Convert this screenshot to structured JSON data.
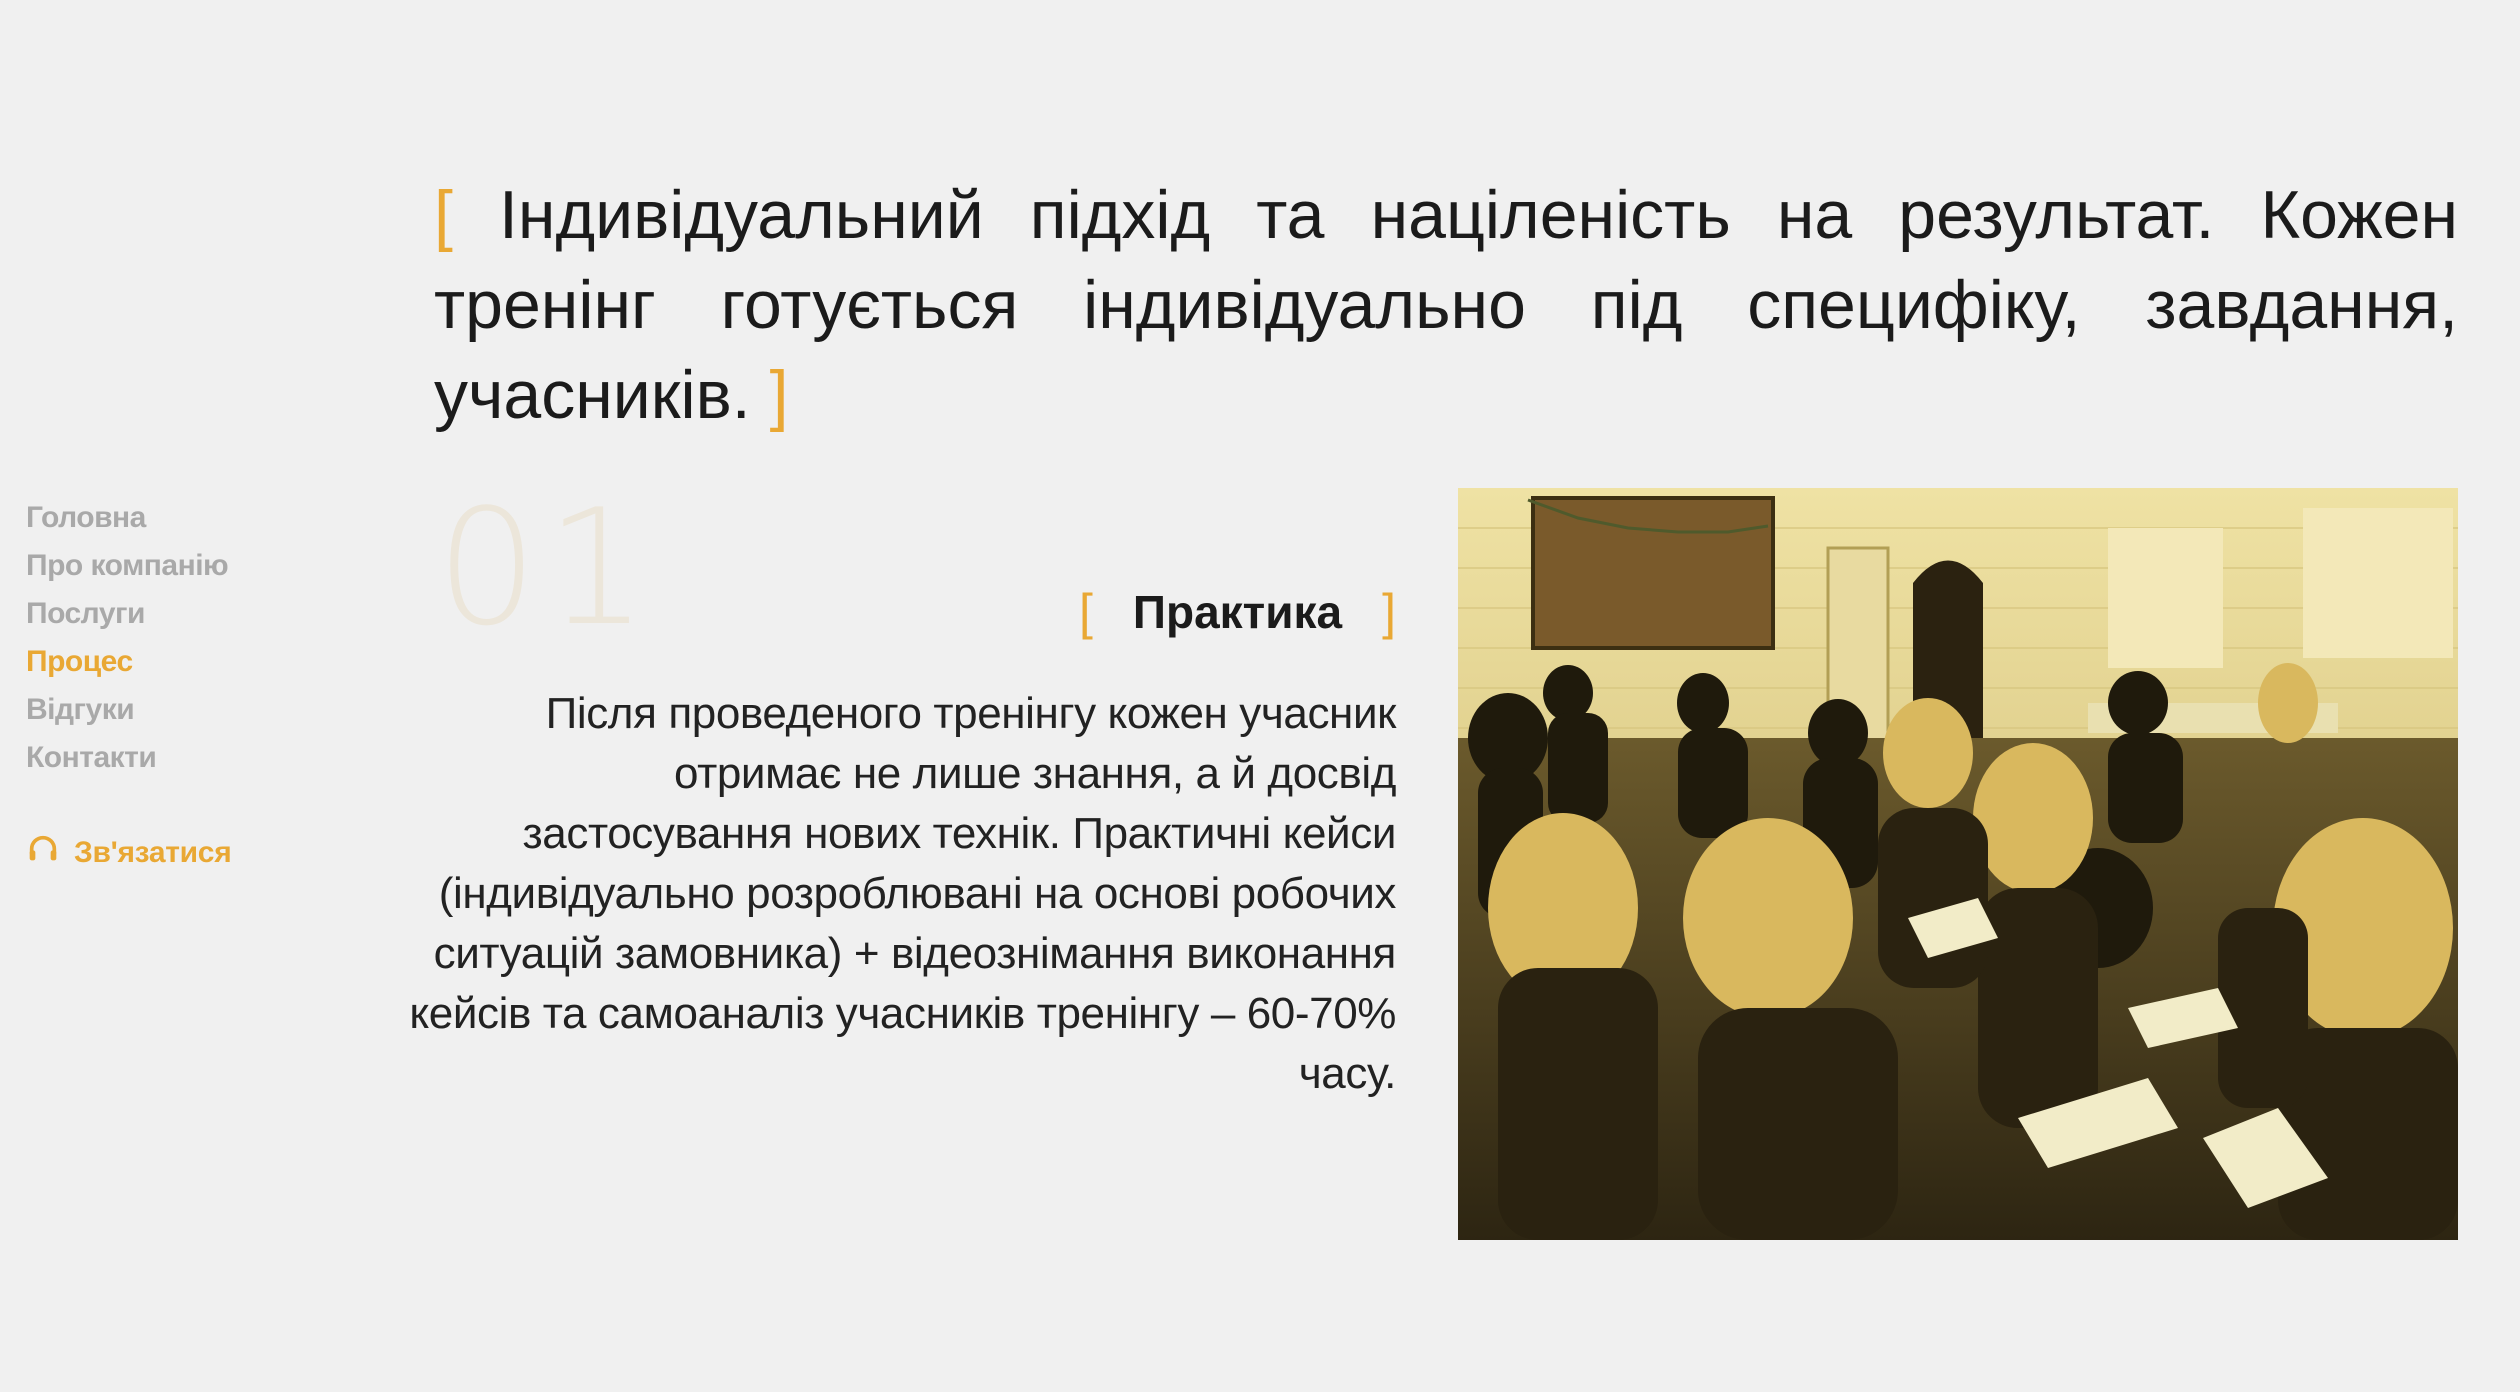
{
  "nav": {
    "items": [
      {
        "label": "Головна",
        "active": false
      },
      {
        "label": "Про компанію",
        "active": false
      },
      {
        "label": "Послуги",
        "active": false
      },
      {
        "label": "Процес",
        "active": true
      },
      {
        "label": "Відгуки",
        "active": false
      },
      {
        "label": "Контакти",
        "active": false
      }
    ],
    "contact_label": "Зв'язатися"
  },
  "headline": {
    "open_bracket": "[",
    "text": "Індивідуальний підхід та націленість на результат. Кожен тренінг готується індивідуально під специфіку, завдання, учасників.",
    "close_bracket": "]"
  },
  "step": {
    "number": "01",
    "title": "Практика",
    "open_bracket": "[",
    "close_bracket": "]",
    "description": "Після проведеного тренінгу кожен учасник отримає не лише знання, а й досвід застосування нових технік. Практичні кейси (індивідуально розроблювані на основі робочих ситуацій замовника) + відеознімання виконання кейсів та самоаналіз учасників тренінгу – 60-70% часу."
  },
  "colors": {
    "accent": "#e9a834",
    "nav_inactive": "#a9a9a9",
    "background": "#f0f0f0",
    "text": "#1b1b1b"
  },
  "icons": {
    "contact": "headset-icon"
  }
}
